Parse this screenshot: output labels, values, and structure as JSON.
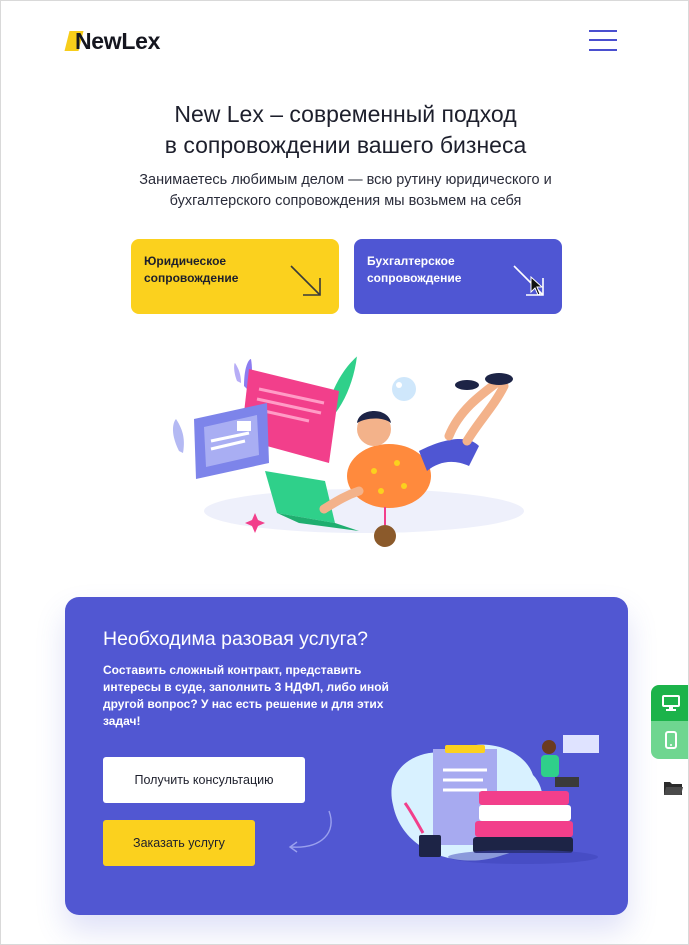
{
  "header": {
    "logo_text": "NewLex",
    "menu_icon": "hamburger-menu-icon"
  },
  "hero": {
    "title_line1": "New Lex – современный подход",
    "title_line2": "в сопровождении вашего бизнеса",
    "subtitle_line1": "Занимаетесь любимым делом — всю рутину юридического и",
    "subtitle_line2": "бухгалтерского сопровождения мы возьмем на себя"
  },
  "services": [
    {
      "line1": "Юридическое",
      "line2": "сопровождение",
      "color": "#fbd11e",
      "icon": "arrow-down-right-icon"
    },
    {
      "line1": "Бухгалтерское",
      "line2": "сопровождение",
      "color": "#4f56d3",
      "icon": "arrow-down-right-icon"
    }
  ],
  "promo": {
    "title": "Необходима разовая услуга?",
    "text_lines": [
      "Составить сложный контракт, представить",
      "интересы в суде, заполнить 3 НДФЛ, либо иной",
      "другой вопрос? У нас есть решение и для этих",
      "задач!"
    ],
    "consult_button": "Получить консультацию",
    "order_button": "Заказать услугу",
    "background": "#5157d2"
  },
  "side_widgets": {
    "desktop_icon": "desktop-icon",
    "mobile_icon": "mobile-phone-icon",
    "folder_icon": "folder-icon",
    "accent": "#1cb34a"
  },
  "colors": {
    "brand_yellow": "#fbd11e",
    "brand_blue": "#4f56d3"
  }
}
